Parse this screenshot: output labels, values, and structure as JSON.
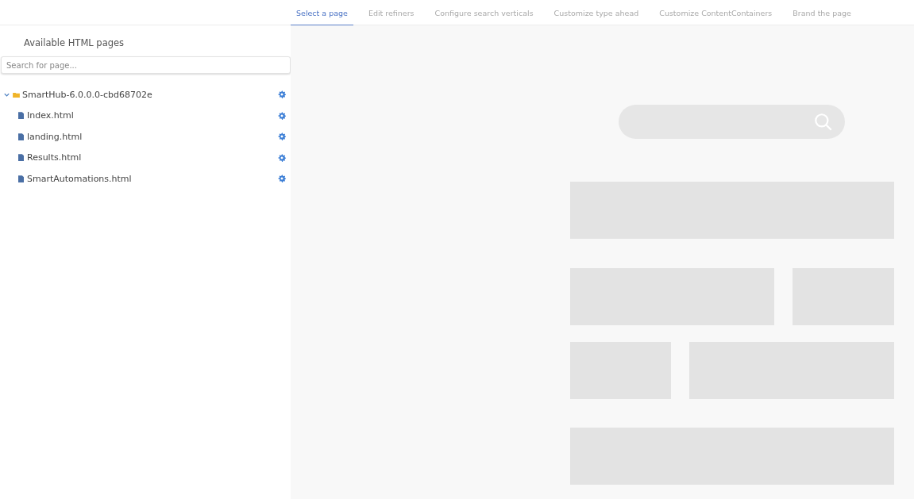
{
  "tabs": [
    {
      "label": "Select a page",
      "selected": true
    },
    {
      "label": "Edit refiners",
      "selected": false
    },
    {
      "label": "Configure search verticals",
      "selected": false
    },
    {
      "label": "Customize type ahead",
      "selected": false
    },
    {
      "label": "Customize ContentContainers",
      "selected": false
    },
    {
      "label": "Brand the page",
      "selected": false
    }
  ],
  "sidebar": {
    "title": "Available HTML pages",
    "search": {
      "placeholder": "Search for page..."
    },
    "tree": [
      {
        "label": "SmartHub-6.0.0.0-cbd68702e",
        "kind": "folder",
        "expanded": true,
        "children": [
          {
            "label": "Index.html",
            "kind": "file"
          },
          {
            "label": "landing.html",
            "kind": "file"
          },
          {
            "label": "Results.html",
            "kind": "file"
          },
          {
            "label": "SmartAutomations.html",
            "kind": "file"
          }
        ]
      }
    ]
  }
}
